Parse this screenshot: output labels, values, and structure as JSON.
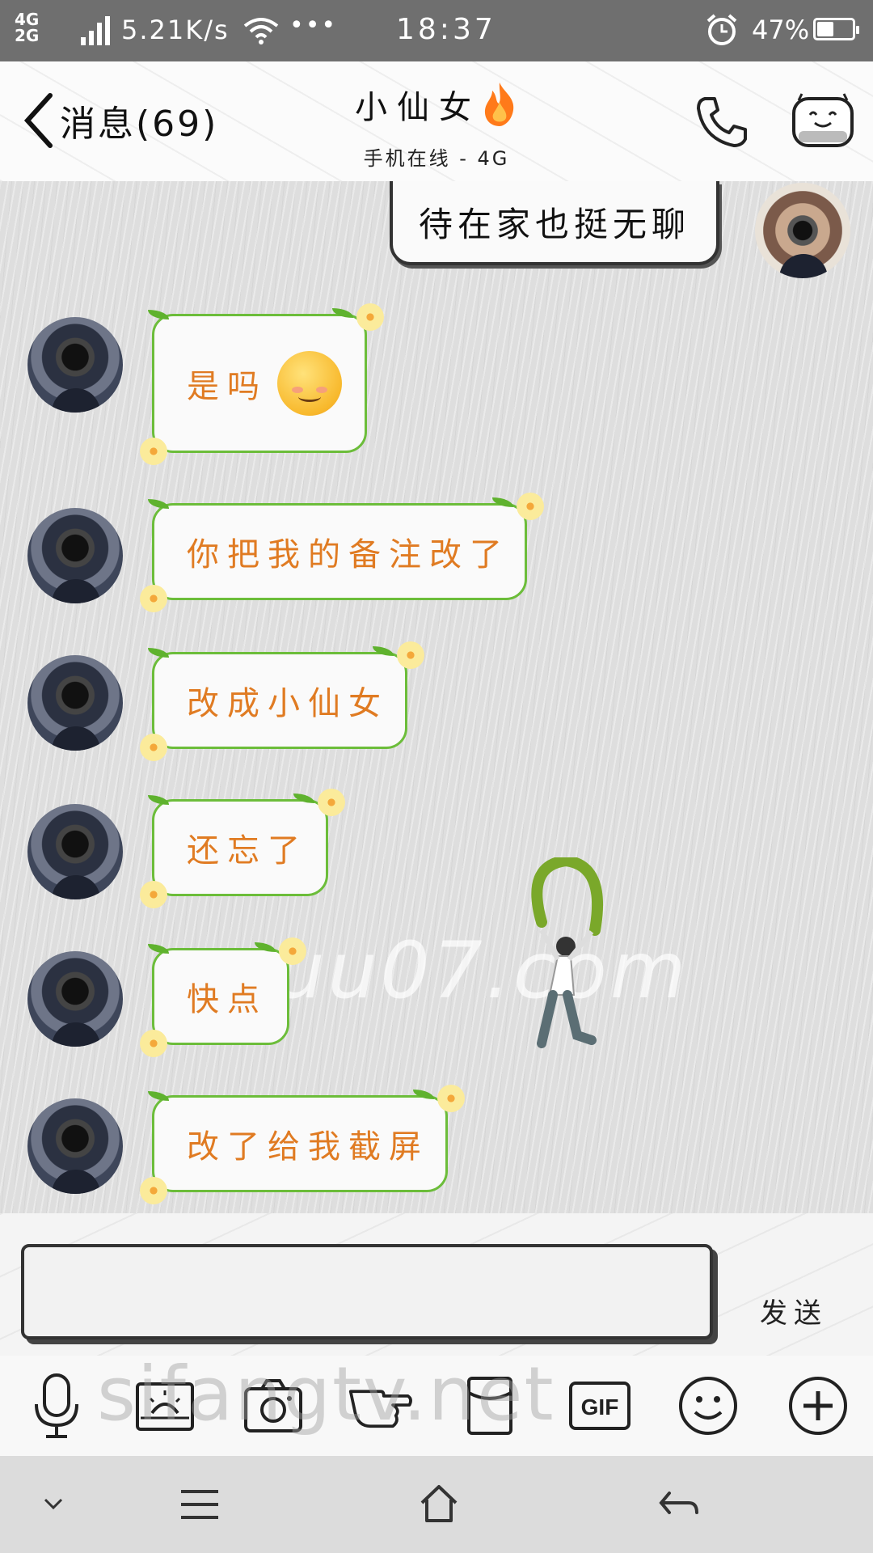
{
  "status_bar": {
    "network_top": "4G",
    "network_bottom": "2G",
    "network_small": "2G",
    "speed": "5.21K/s",
    "dots": "•••",
    "time": "18:37",
    "battery": "47%",
    "battery_level": 0.47
  },
  "header": {
    "back_label": "消息(69)",
    "title": "小仙女",
    "subtitle": "手机在线 - 4G",
    "icons": [
      "back-chevron-icon",
      "fire-icon",
      "phone-icon",
      "robot-face-icon"
    ]
  },
  "messages": [
    {
      "from": "me",
      "text": "待在家也挺无聊"
    },
    {
      "from": "them",
      "text": "是吗",
      "emoji": "shy-smile-emoji"
    },
    {
      "from": "them",
      "text": "你把我的备注改了"
    },
    {
      "from": "them",
      "text": "改成小仙女"
    },
    {
      "from": "them",
      "text": "还忘了"
    },
    {
      "from": "them",
      "text": "快点"
    },
    {
      "from": "them",
      "text": "改了给我截屏"
    }
  ],
  "watermarks": [
    "xuu07.com",
    "sifangtv.net"
  ],
  "input": {
    "value": "",
    "send_label": "发送"
  },
  "toolbar": {
    "icons": [
      "microphone-icon",
      "photo-icon",
      "camera-icon",
      "poke-hand-icon",
      "red-packet-icon",
      "gif-icon",
      "emoji-icon",
      "plus-icon"
    ],
    "gif_label": "GIF"
  },
  "navbar": {
    "icons": [
      "chevron-down-icon",
      "menu-icon",
      "home-icon",
      "back-arrow-icon"
    ]
  }
}
